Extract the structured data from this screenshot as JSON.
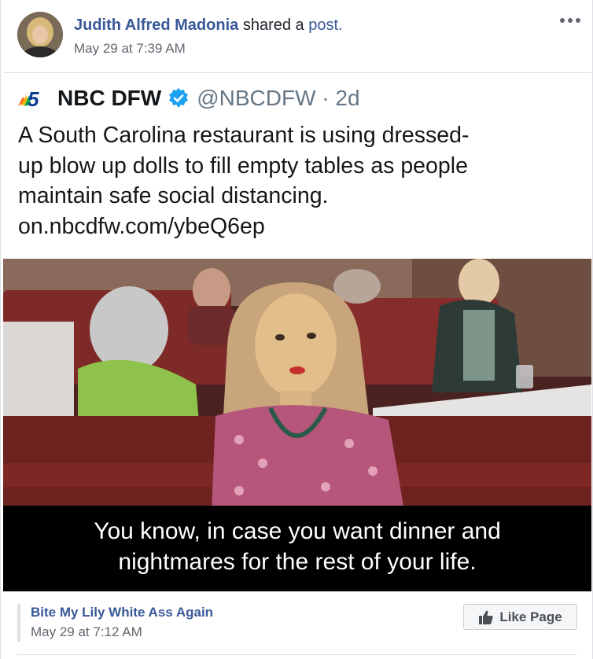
{
  "post": {
    "author_name": "Judith Alfred Madonia",
    "action_text": " shared a ",
    "post_link": "post.",
    "timestamp": "May 29 at 7:39 AM",
    "more_icon": "more-horizontal-icon"
  },
  "tweet": {
    "account_name": "NBC DFW",
    "handle": "@NBCDFW · 2d",
    "text_lines": [
      "A South Carolina restaurant is using dressed-",
      "up blow up dolls to fill empty tables as people",
      "maintain safe social distancing.",
      "on.nbcdfw.com/ybeQ6ep"
    ],
    "logo_text": "5",
    "verified_icon": "verified-badge-icon"
  },
  "photo_caption": {
    "lines": [
      "You know, in case you want dinner and",
      "nightmares for the rest of your life."
    ]
  },
  "source": {
    "page_name": "Bite My Lily White Ass Again",
    "timestamp": "May 29 at 7:12 AM",
    "like_button_label": "Like Page",
    "like_icon": "thumbs-up-icon"
  },
  "colors": {
    "link_blue": "#385898",
    "twitter_blue": "#1da1f2",
    "meta_gray": "#616770"
  }
}
